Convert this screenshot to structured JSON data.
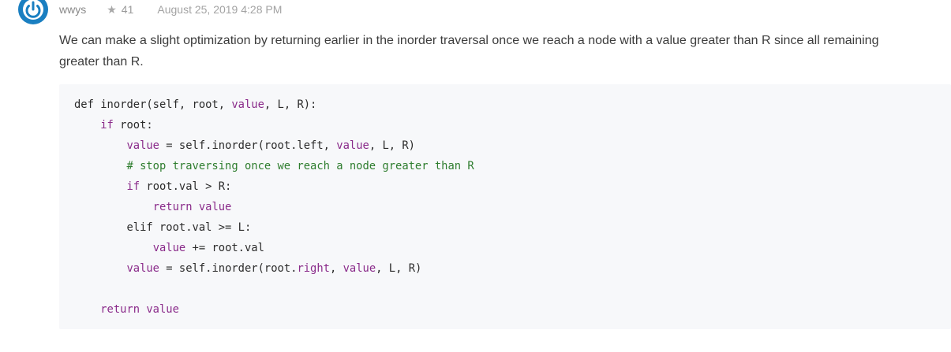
{
  "post": {
    "author": "wwys",
    "votes": "41",
    "star_icon": "star-icon",
    "date": "August 25, 2019 4:28 PM",
    "avatar_icon": "power-icon",
    "text_line_1": "We can make a slight optimization by returning earlier in the inorder traversal once we reach a node with a value greater than R since all remaining",
    "text_line_2": "greater than R."
  },
  "code": {
    "lines": [
      [
        {
          "t": "pl",
          "s": "def inorder(self, root, "
        },
        {
          "t": "kw",
          "s": "value"
        },
        {
          "t": "pl",
          "s": ", L, R):"
        }
      ],
      [
        {
          "t": "pl",
          "s": "    "
        },
        {
          "t": "kw",
          "s": "if"
        },
        {
          "t": "pl",
          "s": " root:"
        }
      ],
      [
        {
          "t": "pl",
          "s": "        "
        },
        {
          "t": "kw",
          "s": "value"
        },
        {
          "t": "pl",
          "s": " = self.inorder(root.left, "
        },
        {
          "t": "kw",
          "s": "value"
        },
        {
          "t": "pl",
          "s": ", L, R)"
        }
      ],
      [
        {
          "t": "pl",
          "s": "        "
        },
        {
          "t": "cm",
          "s": "# stop traversing once we reach a node greater than R"
        }
      ],
      [
        {
          "t": "pl",
          "s": "        "
        },
        {
          "t": "kw",
          "s": "if"
        },
        {
          "t": "pl",
          "s": " root.val > R:"
        }
      ],
      [
        {
          "t": "pl",
          "s": "            "
        },
        {
          "t": "kw",
          "s": "return value"
        }
      ],
      [
        {
          "t": "pl",
          "s": "        elif root.val >= L:"
        }
      ],
      [
        {
          "t": "pl",
          "s": "            "
        },
        {
          "t": "kw",
          "s": "value"
        },
        {
          "t": "pl",
          "s": " += root.val"
        }
      ],
      [
        {
          "t": "pl",
          "s": "        "
        },
        {
          "t": "kw",
          "s": "value"
        },
        {
          "t": "pl",
          "s": " = self.inorder(root."
        },
        {
          "t": "kw",
          "s": "right"
        },
        {
          "t": "pl",
          "s": ", "
        },
        {
          "t": "kw",
          "s": "value"
        },
        {
          "t": "pl",
          "s": ", L, R)"
        }
      ],
      [],
      [
        {
          "t": "pl",
          "s": "    "
        },
        {
          "t": "kw",
          "s": "return value"
        }
      ]
    ]
  },
  "colors": {
    "avatar": "#1a7fc1",
    "keyword": "#8a2b8a",
    "comment": "#2e7d2e",
    "code_bg": "#f7f8fa"
  }
}
